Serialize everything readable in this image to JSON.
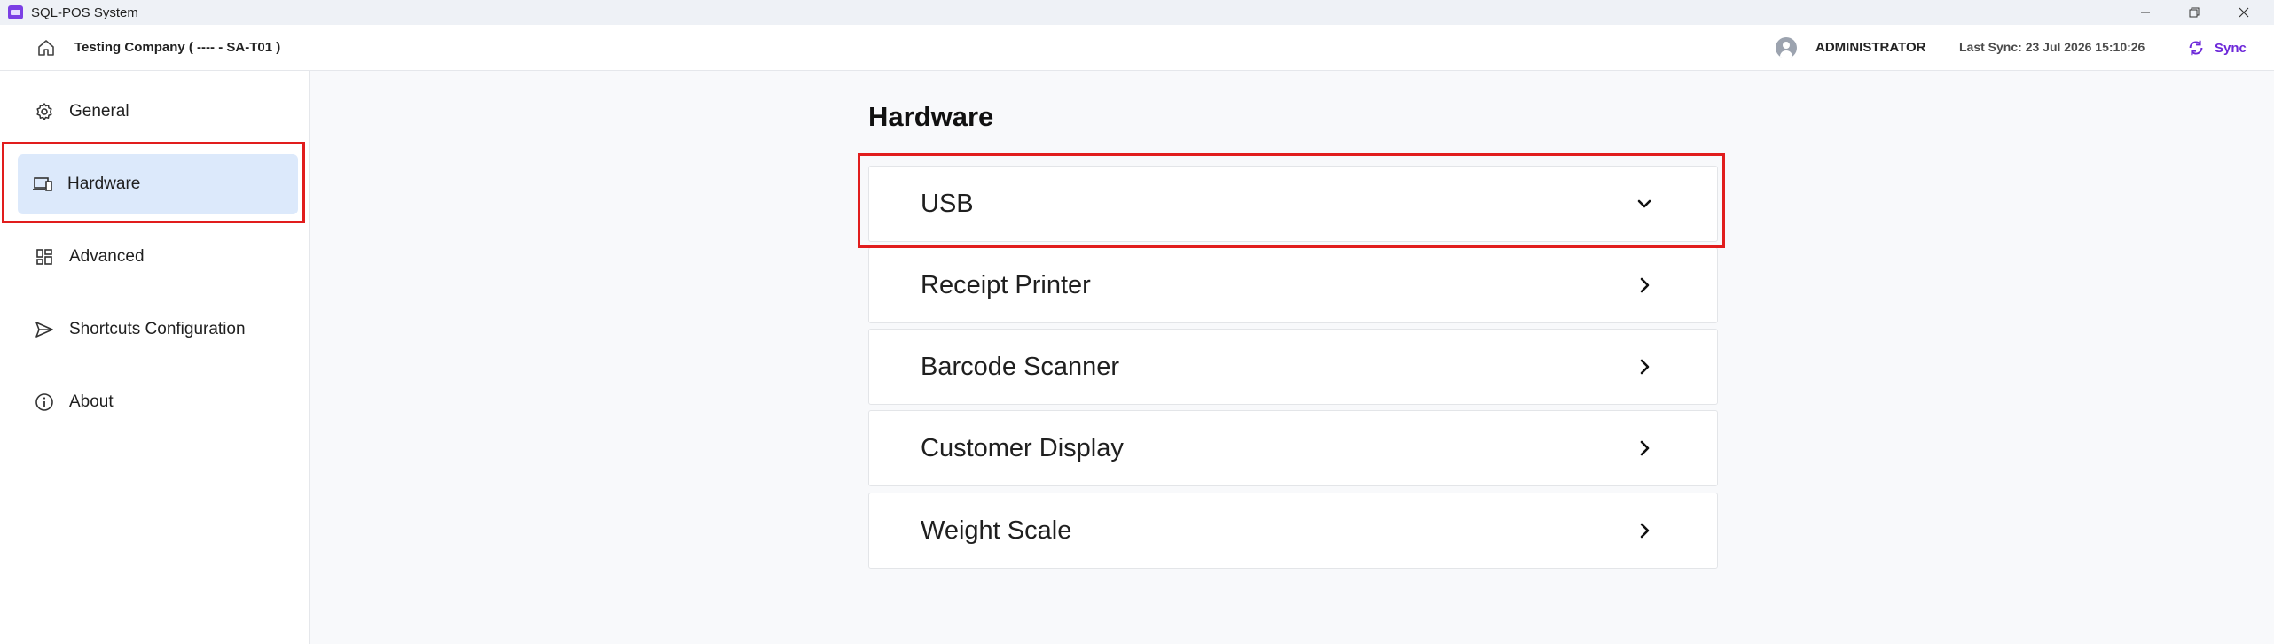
{
  "window": {
    "title": "SQL-POS System"
  },
  "header": {
    "company": "Testing Company ( ---- - SA-T01 )",
    "user": "ADMINISTRATOR",
    "last_sync": "Last Sync: 23 Jul 2026 15:10:26",
    "sync_label": "Sync",
    "accent_color": "#6d28d9"
  },
  "sidebar": {
    "items": [
      {
        "label": "General",
        "icon": "gear-icon",
        "active": false
      },
      {
        "label": "Hardware",
        "icon": "devices-icon",
        "active": true
      },
      {
        "label": "Advanced",
        "icon": "dashboard-icon",
        "active": false
      },
      {
        "label": "Shortcuts Configuration",
        "icon": "send-icon",
        "active": false
      },
      {
        "label": "About",
        "icon": "info-icon",
        "active": false
      }
    ]
  },
  "main": {
    "title": "Hardware",
    "sections": [
      {
        "label": "USB",
        "expanded": true,
        "icon": "chevron-down-icon"
      },
      {
        "label": "Receipt Printer",
        "expanded": false,
        "icon": "chevron-right-icon"
      },
      {
        "label": "Barcode Scanner",
        "expanded": false,
        "icon": "chevron-right-icon"
      },
      {
        "label": "Customer Display",
        "expanded": false,
        "icon": "chevron-right-icon"
      },
      {
        "label": "Weight Scale",
        "expanded": false,
        "icon": "chevron-right-icon"
      }
    ]
  },
  "highlight_color": "#e11d1d"
}
